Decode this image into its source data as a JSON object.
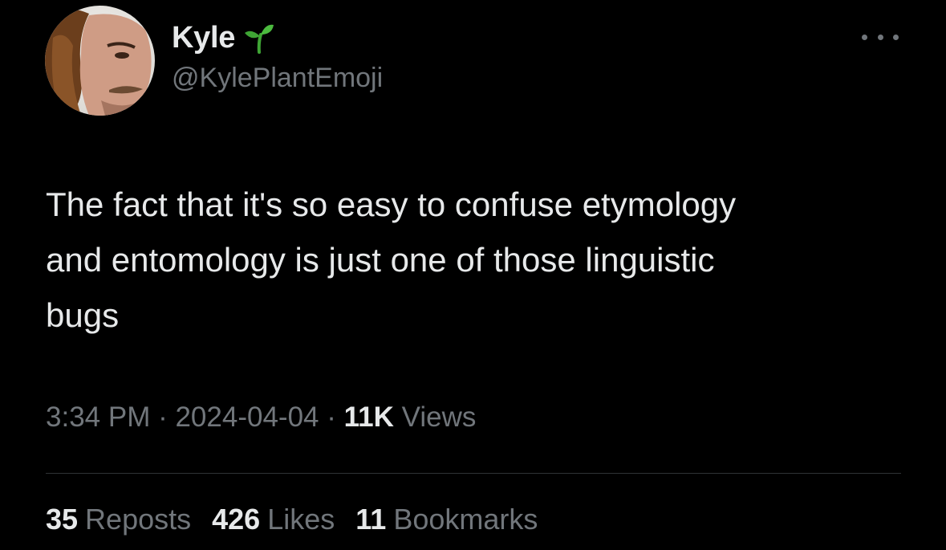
{
  "author": {
    "display_name": "Kyle",
    "name_emoji": "sprout-icon",
    "handle": "@KylePlantEmoji"
  },
  "tweet": {
    "text": "The fact that it's so easy to confuse etymology\nand entomology is just one of those linguistic\nbugs"
  },
  "meta": {
    "time": "3:34 PM",
    "separator": " · ",
    "date": "2024-04-04",
    "views_count": "11K",
    "views_label": "Views"
  },
  "stats": {
    "reposts_count": "35",
    "reposts_label": "Reposts",
    "likes_count": "426",
    "likes_label": "Likes",
    "bookmarks_count": "11",
    "bookmarks_label": "Bookmarks"
  },
  "colors": {
    "background": "#000000",
    "primary_text": "#e7e9ea",
    "secondary_text": "#71767b",
    "divider": "#2f3336",
    "sprout_green": "#3fa535"
  }
}
